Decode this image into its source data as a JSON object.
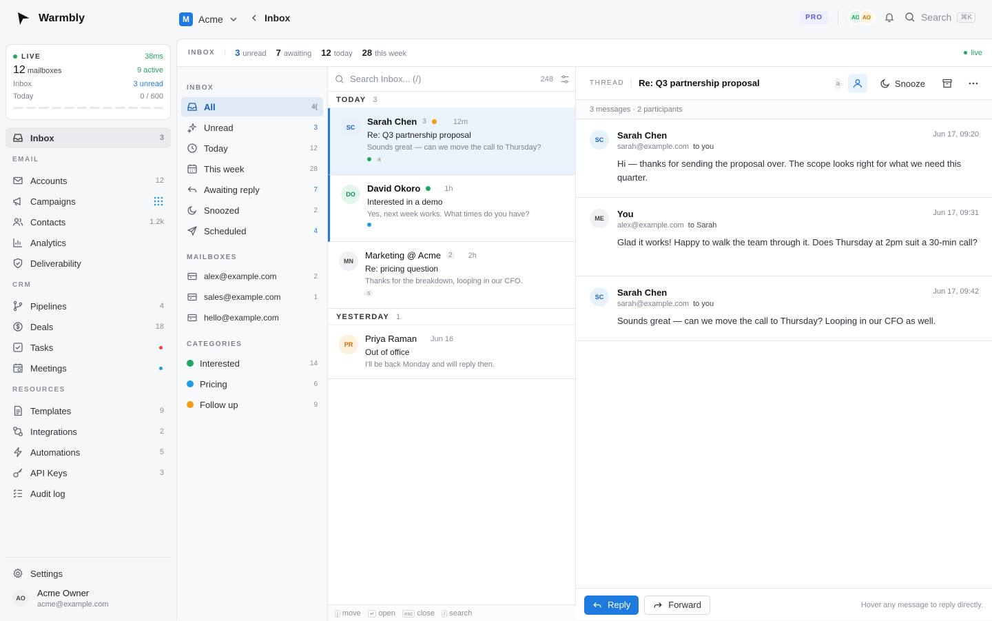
{
  "app": {
    "name": "Warmbly"
  },
  "workspace": {
    "badge": "M",
    "name": "Acme"
  },
  "breadcrumb": {
    "current": "Inbox"
  },
  "topbar": {
    "plan": "PRO",
    "avatars": [
      "AO",
      "AO"
    ],
    "search_label": "Search",
    "search_shortcut": "⌘K"
  },
  "live": {
    "label": "LIVE",
    "latency": "38ms",
    "mailboxes_count": "12",
    "mailboxes_label": "mailboxes",
    "active": "9 active",
    "inbox_label": "Inbox",
    "inbox_value": "3 unread",
    "today_label": "Today",
    "today_value": "0 / 600"
  },
  "nav": {
    "inbox": {
      "label": "Inbox",
      "count": "3"
    },
    "email_section": "EMAIL",
    "email": [
      {
        "label": "Accounts",
        "count": "12"
      },
      {
        "label": "Campaigns",
        "count": ""
      },
      {
        "label": "Contacts",
        "count": "1.2k"
      },
      {
        "label": "Analytics",
        "count": ""
      },
      {
        "label": "Deliverability",
        "count": ""
      }
    ],
    "crm_section": "CRM",
    "crm": [
      {
        "label": "Pipelines",
        "count": "4"
      },
      {
        "label": "Deals",
        "count": "18"
      },
      {
        "label": "Tasks",
        "count": ""
      },
      {
        "label": "Meetings",
        "count": ""
      }
    ],
    "resources_section": "RESOURCES",
    "resources": [
      {
        "label": "Templates",
        "count": "9"
      },
      {
        "label": "Integrations",
        "count": "2"
      },
      {
        "label": "Automations",
        "count": "5"
      },
      {
        "label": "API Keys",
        "count": "3"
      },
      {
        "label": "Audit log",
        "count": ""
      }
    ],
    "settings": "Settings"
  },
  "user": {
    "initials": "AO",
    "name": "Acme Owner",
    "email": "acme@example.com"
  },
  "stats": {
    "label": "INBOX",
    "unread_n": "3",
    "unread": "unread",
    "awaiting_n": "7",
    "awaiting": "awaiting",
    "today_n": "12",
    "today": "today",
    "week_n": "28",
    "week": "this week",
    "live": "live"
  },
  "folders": {
    "inbox_section": "INBOX",
    "items": [
      {
        "label": "All",
        "count": "4("
      },
      {
        "label": "Unread",
        "count": "3"
      },
      {
        "label": "Today",
        "count": "12"
      },
      {
        "label": "This week",
        "count": "28"
      },
      {
        "label": "Awaiting reply",
        "count": "7"
      },
      {
        "label": "Snoozed",
        "count": "2"
      },
      {
        "label": "Scheduled",
        "count": "4"
      }
    ],
    "mailboxes_section": "MAILBOXES",
    "mailboxes": [
      {
        "label": "alex@example.com",
        "count": "2"
      },
      {
        "label": "sales@example.com",
        "count": "1"
      },
      {
        "label": "hello@example.com",
        "count": ""
      }
    ],
    "categories_section": "CATEGORIES",
    "categories": [
      {
        "label": "Interested",
        "count": "14",
        "color": "#1ea463"
      },
      {
        "label": "Pricing",
        "count": "6",
        "color": "#1f9be0"
      },
      {
        "label": "Follow up",
        "count": "9",
        "color": "#f29b0f"
      }
    ]
  },
  "list": {
    "search_placeholder": "Search Inbox... (/)",
    "total": "248",
    "today_group": "TODAY",
    "today_count": "3",
    "yesterday_group": "YESTERDAY",
    "yesterday_count": "1",
    "messages": [
      {
        "initials": "SC",
        "name": "Sarah Chen",
        "count": "3",
        "time": "12m",
        "subject": "Re: Q3 partnership proposal",
        "preview": "Sounds great — can we move the call to Thursday?",
        "tag": "a"
      },
      {
        "initials": "DO",
        "name": "David Okoro",
        "count": "",
        "time": "1h",
        "subject": "Interested in a demo",
        "preview": "Yes, next week works. What times do you have?",
        "tag": ""
      },
      {
        "initials": "MN",
        "name": "Marketing @ Acme",
        "count": "2",
        "time": "2h",
        "subject": "Re: pricing question",
        "preview": "Thanks for the breakdown, looping in our CFO.",
        "tag": "s"
      },
      {
        "initials": "PR",
        "name": "Priya Raman",
        "count": "",
        "time": "Jun 16",
        "subject": "Out of office",
        "preview": "I'll be back Monday and will reply then.",
        "tag": ""
      }
    ],
    "footer": {
      "move_key": "j",
      "move": "move",
      "open_key": "↵",
      "open": "open",
      "close_key": "esc",
      "close": "close",
      "search_key": "/",
      "search": "search"
    }
  },
  "thread": {
    "label": "THREAD",
    "title": "Re: Q3 partnership proposal",
    "tag": "a",
    "snooze": "Snooze",
    "meta": "3 messages · 2 participants",
    "messages": [
      {
        "initials": "SC",
        "name": "Sarah Chen",
        "email": "sarah@example.com",
        "to": "to you",
        "date": "Jun 17, 09:20",
        "body": "Hi — thanks for sending the proposal over. The scope looks right for what we need this quarter."
      },
      {
        "initials": "ME",
        "name": "You",
        "email": "alex@example.com",
        "to": "to Sarah",
        "date": "Jun 17, 09:31",
        "body": "Glad it works! Happy to walk the team through it. Does Thursday at 2pm suit a 30-min call?"
      },
      {
        "initials": "SC",
        "name": "Sarah Chen",
        "email": "sarah@example.com",
        "to": "to you",
        "date": "Jun 17, 09:42",
        "body": "Sounds great — can we move the call to Thursday? Looping in our CFO as well."
      }
    ],
    "reply": "Reply",
    "forward": "Forward",
    "hint": "Hover any message to reply directly."
  }
}
